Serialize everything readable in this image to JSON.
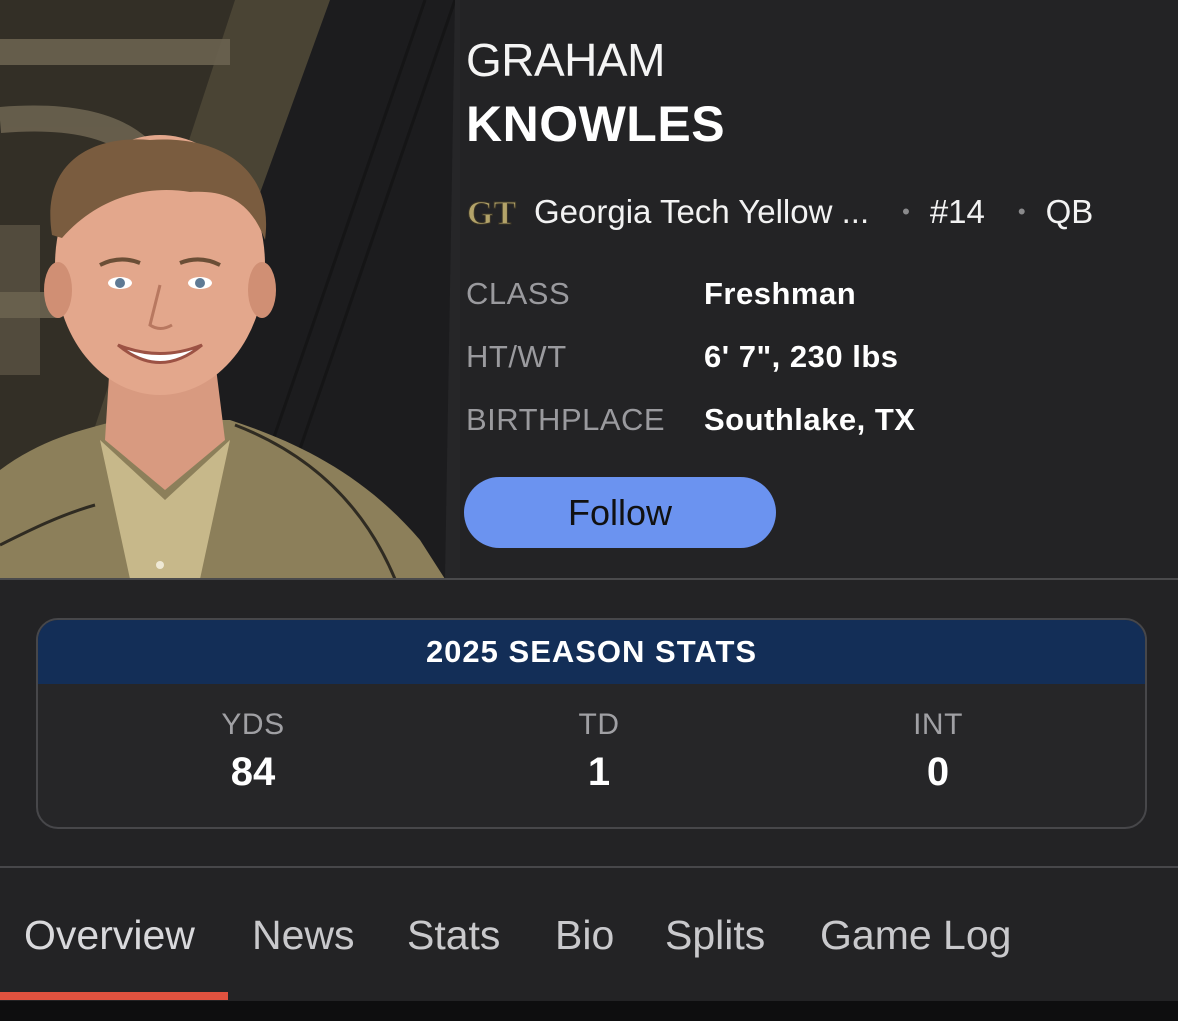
{
  "player": {
    "first_name": "GRAHAM",
    "last_name": "KNOWLES",
    "team_name": "Georgia Tech Yellow ...",
    "team_logo_text": "GT",
    "jersey": "#14",
    "position": "QB",
    "separator": "•"
  },
  "attributes": [
    {
      "label": "CLASS",
      "value": "Freshman"
    },
    {
      "label": "HT/WT",
      "value": "6' 7\", 230 lbs"
    },
    {
      "label": "BIRTHPLACE",
      "value": "Southlake, TX"
    }
  ],
  "follow_label": "Follow",
  "season_stats": {
    "title": "2025 SEASON STATS",
    "stats": [
      {
        "label": "YDS",
        "value": "84"
      },
      {
        "label": "TD",
        "value": "1"
      },
      {
        "label": "INT",
        "value": "0"
      }
    ]
  },
  "tabs": [
    {
      "label": "Overview",
      "active": true
    },
    {
      "label": "News",
      "active": false
    },
    {
      "label": "Stats",
      "active": false
    },
    {
      "label": "Bio",
      "active": false
    },
    {
      "label": "Splits",
      "active": false
    },
    {
      "label": "Game Log",
      "active": false
    }
  ],
  "colors": {
    "background": "#232325",
    "accent_blue": "#6b93f0",
    "stats_header": "#132e57",
    "tab_indicator": "#e0523f",
    "team_gold": "#b3a369"
  },
  "icons": {
    "team_logo": "georgia-tech-logo-icon",
    "player_photo": "player-headshot"
  }
}
